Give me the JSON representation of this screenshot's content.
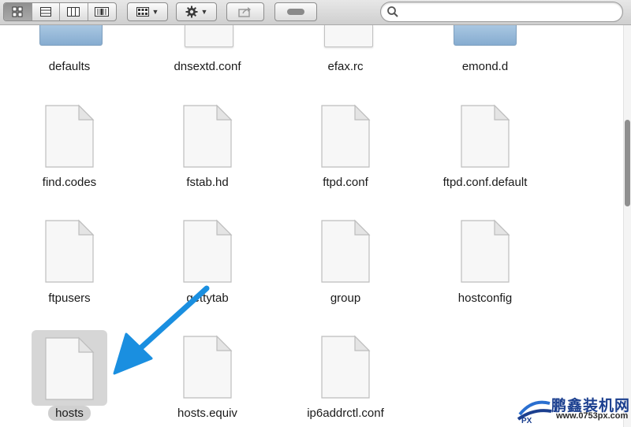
{
  "toolbar": {
    "view_buttons": [
      {
        "name": "icon-view-button",
        "icon": "grid-icon",
        "active": true
      },
      {
        "name": "list-view-button",
        "icon": "list-icon",
        "active": false
      },
      {
        "name": "column-view-button",
        "icon": "columns-icon",
        "active": false
      },
      {
        "name": "coverflow-view-button",
        "icon": "coverflow-icon",
        "active": false
      }
    ],
    "arrange_icon": "arrange-grid-icon",
    "action_icon": "gear-icon",
    "share_icon": "share-icon",
    "tags_icon": "tag-pill-icon",
    "search": {
      "value": "",
      "placeholder": "",
      "icon": "search-icon"
    }
  },
  "files_top_row": [
    {
      "name": "defaults",
      "kind": "folder"
    },
    {
      "name": "dnsextd.conf",
      "kind": "document"
    },
    {
      "name": "efax.rc",
      "kind": "document"
    },
    {
      "name": "emond.d",
      "kind": "folder"
    }
  ],
  "files": [
    {
      "name": "find.codes",
      "kind": "document"
    },
    {
      "name": "fstab.hd",
      "kind": "document"
    },
    {
      "name": "ftpd.conf",
      "kind": "document"
    },
    {
      "name": "ftpd.conf.default",
      "kind": "document"
    },
    {
      "name": "ftpusers",
      "kind": "document"
    },
    {
      "name": "gettytab",
      "kind": "document"
    },
    {
      "name": "group",
      "kind": "document"
    },
    {
      "name": "hostconfig",
      "kind": "document"
    },
    {
      "name": "hosts",
      "kind": "document",
      "selected": true
    },
    {
      "name": "hosts.equiv",
      "kind": "document"
    },
    {
      "name": "ip6addrctl.conf",
      "kind": "document"
    }
  ],
  "annotation": {
    "color": "#1a8fe0",
    "icon": "pointer-arrow"
  },
  "watermark": {
    "title": "鹏鑫装机网",
    "url": "www.0753px.com"
  },
  "colors": {
    "selection": "#d6d6d6",
    "folder": "#99bbdd",
    "toolbar": "#dcdcdc"
  }
}
